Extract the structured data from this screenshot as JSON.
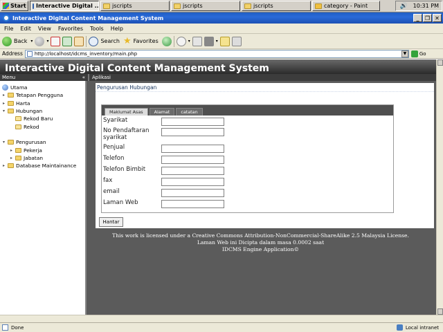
{
  "taskbar": {
    "start_label": "Start",
    "tasks": [
      {
        "label": "Interactive Digital ..."
      },
      {
        "label": "jscripts"
      },
      {
        "label": "jscripts"
      },
      {
        "label": "jscripts"
      },
      {
        "label": "category - Paint"
      }
    ],
    "clock": "10:31 PM"
  },
  "window": {
    "title": "Interactive Digital Content Management System"
  },
  "menubar": [
    "File",
    "Edit",
    "View",
    "Favorites",
    "Tools",
    "Help"
  ],
  "toolbar": {
    "back_label": "Back",
    "search_label": "Search",
    "favorites_label": "Favorites"
  },
  "address": {
    "label": "Address",
    "url": "http://localhost/idcms_inventory/main.php",
    "go_label": "Go"
  },
  "app": {
    "header_title": "Interactive Digital Content Management System",
    "left_strip": "Menu",
    "right_strip": "Aplikasi",
    "collapse_glyph": "«"
  },
  "tree": {
    "items": [
      {
        "label": "Utama"
      },
      {
        "label": "Tetapan Pengguna"
      },
      {
        "label": "Harta"
      },
      {
        "label": "Hubungan"
      },
      {
        "label": "Rekod Baru"
      },
      {
        "label": "Rekod"
      },
      {
        "label": ""
      },
      {
        "label": "Pengurusan"
      },
      {
        "label": "Pekerja"
      },
      {
        "label": "Jabatan"
      },
      {
        "label": "Database Maintainance"
      }
    ]
  },
  "content": {
    "panel_title": "Pengurusan Hubungan",
    "tabs": [
      "Maklumat Asas",
      "Alamat",
      "catatan"
    ],
    "fields": [
      {
        "label": "Syarikat"
      },
      {
        "label": "No Pendaftaran syarikat"
      },
      {
        "label": "Penjual"
      },
      {
        "label": "Telefon"
      },
      {
        "label": "Telefon Bimbit"
      },
      {
        "label": "fax"
      },
      {
        "label": "email"
      },
      {
        "label": "Laman Web"
      }
    ],
    "submit_label": "Hantar"
  },
  "footer": {
    "line1": "This work is licensed under a Creative Commons Attribution-NonCommercial-ShareAlike 2.5 Malaysia License.",
    "line2": "Laman Web ini Dicipta dalam masa 0.0002 saat",
    "line3": "IDCMS Engine Application©"
  },
  "statusbar": {
    "left": "Done",
    "zone": "Local intranet"
  }
}
